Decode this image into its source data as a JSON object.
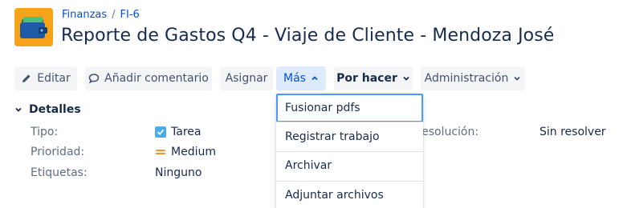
{
  "breadcrumb": {
    "project": "Finanzas",
    "separator": "/",
    "issue_key": "FI-6"
  },
  "issue": {
    "title": "Reporte de Gastos Q4 - Viaje de Cliente - Mendoza José"
  },
  "toolbar": {
    "edit_label": "Editar",
    "comment_label": "Añadir comentario",
    "assign_label": "Asignar",
    "more_label": "Más",
    "status_label": "Por hacer",
    "admin_label": "Administración"
  },
  "more_menu": {
    "items": [
      "Fusionar pdfs",
      "Registrar trabajo",
      "Archivar",
      "Adjuntar archivos"
    ]
  },
  "details": {
    "section_label": "Detalles",
    "type_label": "Tipo:",
    "type_value": "Tarea",
    "priority_label": "Prioridad:",
    "priority_value": "Medium",
    "labels_label": "Etiquetas:",
    "labels_value": "Ninguno",
    "resolution_label": "Resolución:",
    "resolution_value": "Sin resolver"
  },
  "colors": {
    "accent": "#0052cc",
    "avatar_bg": "#f6a21b",
    "task_icon": "#4bade8",
    "priority_medium": "#f79232"
  },
  "icons": [
    "wallet-icon",
    "pencil-icon",
    "comment-icon",
    "chevron-up-icon",
    "chevron-down-icon",
    "task-check-icon",
    "priority-medium-icon"
  ]
}
